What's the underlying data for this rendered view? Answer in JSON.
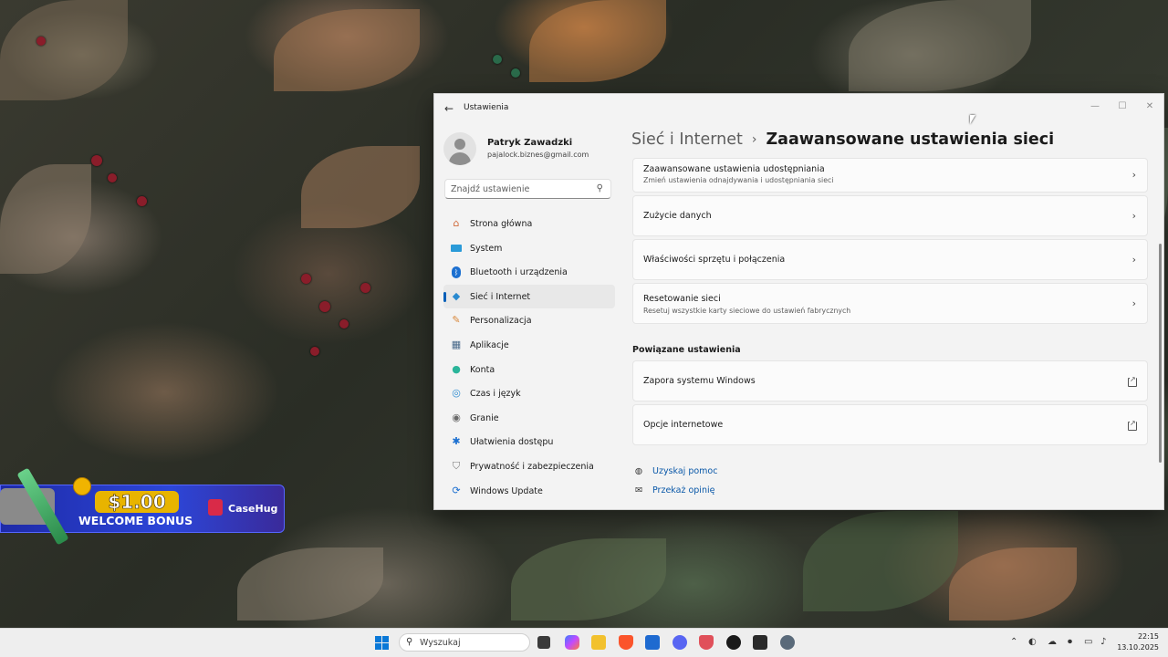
{
  "window": {
    "app_title": "Ustawienia",
    "controls": {
      "minimize": "—",
      "maximize": "☐",
      "close": "✕"
    }
  },
  "profile": {
    "name": "Patryk Zawadzki",
    "email": "pajalock.biznes@gmail.com"
  },
  "search": {
    "placeholder": "Znajdź ustawienie"
  },
  "nav": {
    "items": [
      {
        "label": "Strona główna",
        "icon": "home-icon"
      },
      {
        "label": "System",
        "icon": "monitor-icon"
      },
      {
        "label": "Bluetooth i urządzenia",
        "icon": "bluetooth-icon"
      },
      {
        "label": "Sieć i Internet",
        "icon": "wifi-icon",
        "active": true
      },
      {
        "label": "Personalizacja",
        "icon": "brush-icon"
      },
      {
        "label": "Aplikacje",
        "icon": "apps-icon"
      },
      {
        "label": "Konta",
        "icon": "person-icon"
      },
      {
        "label": "Czas i język",
        "icon": "globe-clock-icon"
      },
      {
        "label": "Granie",
        "icon": "gamepad-icon"
      },
      {
        "label": "Ułatwienia dostępu",
        "icon": "accessibility-icon"
      },
      {
        "label": "Prywatność i zabezpieczenia",
        "icon": "shield-icon"
      },
      {
        "label": "Windows Update",
        "icon": "update-icon"
      }
    ]
  },
  "breadcrumb": {
    "parent": "Sieć i Internet",
    "separator": "›",
    "current": "Zaawansowane ustawienia sieci"
  },
  "cards": [
    {
      "title": "Zaawansowane ustawienia udostępniania",
      "subtitle": "Zmień ustawienia odnajdywania i udostępniania sieci"
    },
    {
      "title": "Zużycie danych",
      "subtitle": ""
    },
    {
      "title": "Właściwości sprzętu i połączenia",
      "subtitle": ""
    },
    {
      "title": "Resetowanie sieci",
      "subtitle": "Resetuj wszystkie karty sieciowe do ustawień fabrycznych"
    }
  ],
  "related": {
    "heading": "Powiązane ustawienia",
    "items": [
      {
        "title": "Zapora systemu Windows"
      },
      {
        "title": "Opcje internetowe"
      }
    ]
  },
  "help": {
    "get_help": "Uzyskaj pomoc",
    "feedback": "Przekaż opinię"
  },
  "promo": {
    "amount": "$1.00",
    "text": "WELCOME BONUS",
    "brand": "CaseHug"
  },
  "taskbar": {
    "search_placeholder": "Wyszukaj",
    "time": "22:15",
    "date": "13.10.2025"
  },
  "colors": {
    "accent": "#005fb8",
    "link": "#0a58a8"
  }
}
